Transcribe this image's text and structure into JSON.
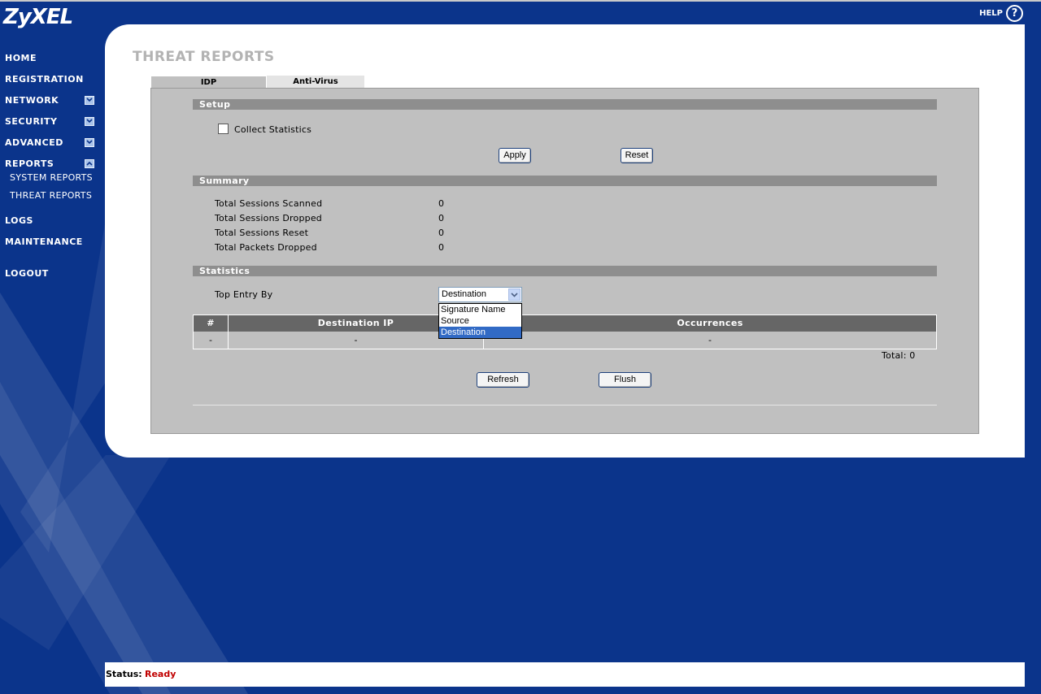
{
  "brand": {
    "logo": "ZyXEL"
  },
  "help": {
    "label": "HELP",
    "icon": "?"
  },
  "nav": {
    "home": "HOME",
    "registration": "REGISTRATION",
    "network": "NETWORK",
    "security": "SECURITY",
    "advanced": "ADVANCED",
    "reports": "REPORTS",
    "system_reports": "SYSTEM REPORTS",
    "threat_reports": "THREAT REPORTS",
    "logs": "LOGS",
    "maintenance": "MAINTENANCE",
    "logout": "LOGOUT"
  },
  "page": {
    "title": "THREAT REPORTS"
  },
  "tabs": {
    "idp": "IDP",
    "anti_virus": "Anti-Virus"
  },
  "setup": {
    "header": "Setup",
    "collect_statistics": "Collect Statistics",
    "collect_statistics_checked": false,
    "apply": "Apply",
    "reset": "Reset"
  },
  "summary": {
    "header": "Summary",
    "rows": [
      {
        "label": "Total Sessions Scanned",
        "value": "0"
      },
      {
        "label": "Total Sessions Dropped",
        "value": "0"
      },
      {
        "label": "Total Sessions Reset",
        "value": "0"
      },
      {
        "label": "Total Packets Dropped",
        "value": "0"
      }
    ]
  },
  "statistics": {
    "header": "Statistics",
    "top_entry_label": "Top Entry By",
    "selected": "Destination",
    "options": [
      "Signature Name",
      "Source",
      "Destination"
    ],
    "table": {
      "headers": [
        "#",
        "Destination IP",
        "Occurrences"
      ],
      "row": [
        "-",
        "-",
        "-"
      ]
    },
    "total": "Total: 0",
    "refresh": "Refresh",
    "flush": "Flush"
  },
  "status": {
    "label": "Status:",
    "value": "Ready"
  },
  "colors": {
    "background": "#0b348b",
    "section_bar": "#8e8e8e",
    "table_header": "#666666",
    "status_ready": "#c00000",
    "selected_option": "#316ac5"
  }
}
